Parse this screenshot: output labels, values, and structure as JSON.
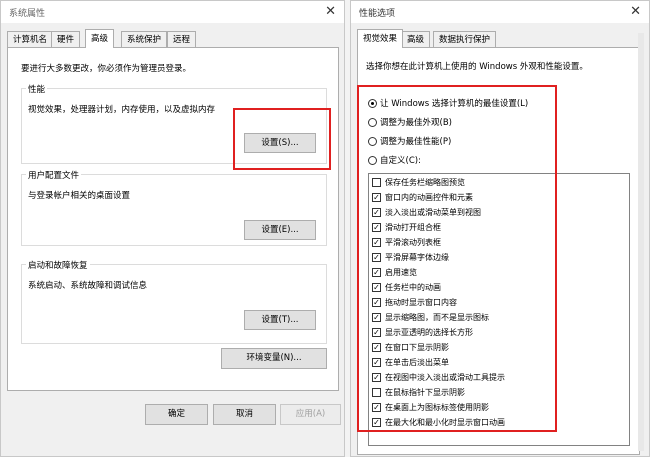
{
  "left_dialog": {
    "title": "系统属性",
    "close_glyph": "✕",
    "tabs": [
      "计算机名",
      "硬件",
      "高级",
      "系统保护",
      "远程"
    ],
    "admin_notice": "要进行大多数更改，你必须作为管理员登录。",
    "performance": {
      "label": "性能",
      "description": "视觉效果，处理器计划，内存使用，以及虚拟内存",
      "button": "设置(S)..."
    },
    "user_profiles": {
      "label": "用户配置文件",
      "description": "与登录帐户相关的桌面设置",
      "button": "设置(E)..."
    },
    "startup_recovery": {
      "label": "启动和故障恢复",
      "description": "系统启动、系统故障和调试信息",
      "button": "设置(T)..."
    },
    "env_button": "环境变量(N)...",
    "ok": "确定",
    "cancel": "取消",
    "apply": "应用(A)"
  },
  "right_dialog": {
    "title": "性能选项",
    "close_glyph": "✕",
    "tabs": [
      "视觉效果",
      "高级",
      "数据执行保护"
    ],
    "intro": "选择你想在此计算机上使用的 Windows 外观和性能设置。",
    "radios": [
      {
        "label": "让 Windows 选择计算机的最佳设置(L)",
        "selected": true
      },
      {
        "label": "调整为最佳外观(B)",
        "selected": false
      },
      {
        "label": "调整为最佳性能(P)",
        "selected": false
      },
      {
        "label": "自定义(C):",
        "selected": false
      }
    ],
    "checkmark": "✓",
    "options": [
      {
        "label": "保存任务栏缩略图预览",
        "checked": false
      },
      {
        "label": "窗口内的动画控件和元素",
        "checked": true
      },
      {
        "label": "淡入淡出或滑动菜单到视图",
        "checked": true
      },
      {
        "label": "滑动打开组合框",
        "checked": true
      },
      {
        "label": "平滑滚动列表框",
        "checked": true
      },
      {
        "label": "平滑屏幕字体边缘",
        "checked": true
      },
      {
        "label": "启用速览",
        "checked": true
      },
      {
        "label": "任务栏中的动画",
        "checked": true
      },
      {
        "label": "拖动时显示窗口内容",
        "checked": true
      },
      {
        "label": "显示缩略图，而不是显示图标",
        "checked": true
      },
      {
        "label": "显示亚透明的选择长方形",
        "checked": true
      },
      {
        "label": "在窗口下显示阴影",
        "checked": true
      },
      {
        "label": "在单击后淡出菜单",
        "checked": true
      },
      {
        "label": "在视图中淡入淡出或滑动工具提示",
        "checked": true
      },
      {
        "label": "在鼠标指针下显示阴影",
        "checked": false
      },
      {
        "label": "在桌面上为图标标签使用阴影",
        "checked": true
      },
      {
        "label": "在最大化和最小化时显示窗口动画",
        "checked": true
      }
    ]
  },
  "colors": {
    "highlight": "#e02020",
    "window_bg": "#f0f0f0",
    "panel_bg": "#ffffff"
  }
}
